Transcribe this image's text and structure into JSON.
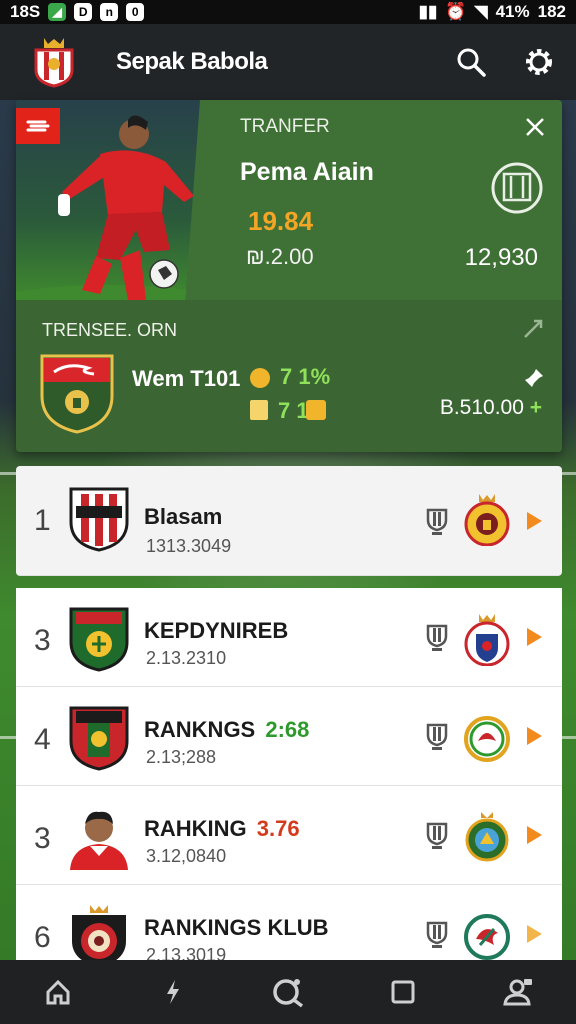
{
  "status_bar": {
    "left_text": "18S",
    "battery": "41%",
    "time": "182"
  },
  "app": {
    "title": "Sepak Babola"
  },
  "transfer_card": {
    "label": "TRANFER",
    "player_name": "Pema Aiain",
    "price": "19.84",
    "sub_price": "₪.2.00",
    "value": "12,930",
    "section_label": "TRENSEE. ORN",
    "club_name": "Wem T101",
    "stat_1": "7 1%",
    "stat_2": "7 1",
    "fee": "B.510.00"
  },
  "rankings": [
    {
      "rank": "1",
      "title": "Blasam",
      "badge": "",
      "badge_color": "",
      "sub": "1313.3049"
    },
    {
      "rank": "3",
      "title": "KEPDYNIREB",
      "badge": "",
      "badge_color": "",
      "sub": "2.13.2310"
    },
    {
      "rank": "4",
      "title": "RANKNGS",
      "badge": "2:68",
      "badge_color": "#2e9a2e",
      "sub": "2.13;288"
    },
    {
      "rank": "3",
      "title": "RAHKING",
      "badge": "3.76",
      "badge_color": "#d43a1e",
      "sub": "3.12,0840"
    },
    {
      "rank": "6",
      "title": "RANKINGS KLUB",
      "badge": "",
      "badge_color": "",
      "sub": "2.13.3019"
    }
  ],
  "colors": {
    "accent_green": "#3d6b37",
    "price_orange": "#f3a526",
    "arrow_orange": "#f28a1e"
  }
}
